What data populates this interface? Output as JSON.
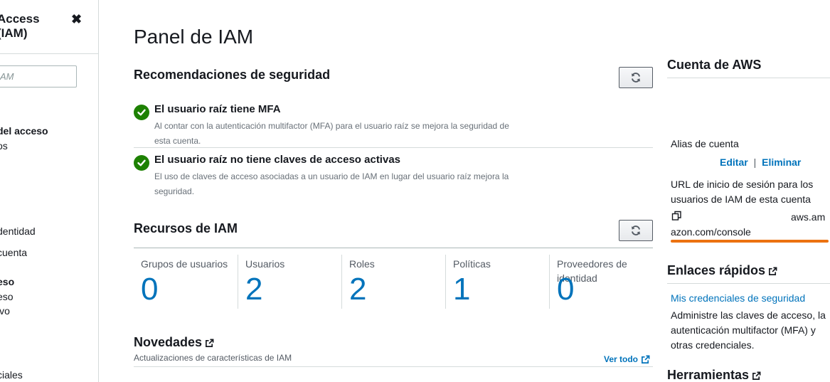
{
  "sidebar": {
    "title_line1": "Access",
    "title_line2": "(IAM)",
    "close_glyph": "✖",
    "search_placeholder": "AM",
    "items": [
      {
        "label": "del acceso",
        "bold": true
      },
      {
        "label": "os",
        "bold": false
      },
      {
        "label": "dentidad",
        "bold": false
      },
      {
        "label": "cuenta",
        "bold": false
      },
      {
        "label": "eso",
        "bold": true
      },
      {
        "label": "eso",
        "bold": false
      },
      {
        "label": "ivo",
        "bold": false
      },
      {
        "label": "ciales",
        "bold": false
      }
    ]
  },
  "main": {
    "page_title": "Panel de IAM",
    "security": {
      "title": "Recomendaciones de seguridad",
      "items": [
        {
          "title": "El usuario raíz tiene MFA",
          "description": "Al contar con la autenticación multifactor (MFA) para el usuario raíz se mejora la seguridad de esta cuenta.",
          "status": "ok"
        },
        {
          "title": "El usuario raíz no tiene claves de acceso activas",
          "description": "El uso de claves de acceso asociadas a un usuario de IAM en lugar del usuario raíz mejora la seguridad.",
          "status": "ok"
        }
      ]
    },
    "resources": {
      "title": "Recursos de IAM",
      "items": [
        {
          "label": "Grupos de usuarios",
          "value": "0"
        },
        {
          "label": "Usuarios",
          "value": "2"
        },
        {
          "label": "Roles",
          "value": "2"
        },
        {
          "label": "Políticas",
          "value": "1"
        },
        {
          "label": "Proveedores de identidad",
          "value": "0"
        }
      ]
    },
    "news": {
      "title": "Novedades",
      "subtitle": "Actualizaciones de características de IAM",
      "see_all": "Ver todo"
    }
  },
  "right": {
    "account_title": "Cuenta de AWS",
    "alias_label": "Alias de cuenta",
    "edit_label": "Editar",
    "link_separator": "|",
    "delete_label": "Eliminar",
    "signin_url_label": "URL de inicio de sesión para los usuarios de IAM de esta cuenta",
    "url_part1": "aws.am",
    "url_part2": "azon.com/console",
    "quick_links_title": "Enlaces rápidos",
    "credentials_link": "Mis credenciales de seguridad",
    "credentials_desc": "Administre las claves de acceso, la autenticación multifactor (MFA) y otras credenciales.",
    "tools_title": "Herramientas"
  },
  "colors": {
    "link": "#0073bb",
    "success": "#1d8102",
    "url_highlight": "#ec7211",
    "text": "#16191f",
    "muted": "#687078"
  },
  "icons": {
    "refresh": "refresh-icon",
    "external": "external-link-icon",
    "check": "check-circle-icon",
    "copy": "copy-icon",
    "close": "close-icon"
  }
}
